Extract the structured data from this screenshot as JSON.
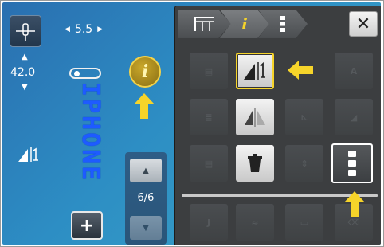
{
  "left": {
    "stitch_width": "5.5",
    "stitch_length": "42.0",
    "pattern_text": "IPHONE",
    "page_counter": "6/6"
  },
  "panel": {
    "tabs": [
      "sewing-frame-icon",
      "info-icon",
      "more-vertical-icon"
    ],
    "close_icon": "close-icon",
    "rows": [
      [
        "memory-rec-icon",
        "mirror-left-right-icon",
        "alphabet-size-icon"
      ],
      [
        "pattern-repeat-icon",
        "mirror-vertical-icon",
        "angle-icon",
        "angle-alt-icon"
      ],
      [
        "memory-rec-icon",
        "delete-icon",
        "split-icon",
        "more-vertical-icon"
      ]
    ],
    "bottom_row": [
      "hook-icon",
      "zigzag-icon",
      "frame-icon",
      "clear-icon"
    ]
  },
  "colors": {
    "accent_yellow": "#f6d42a",
    "background_blue": "#2d8ec4",
    "panel_dark": "#3c3e40"
  }
}
